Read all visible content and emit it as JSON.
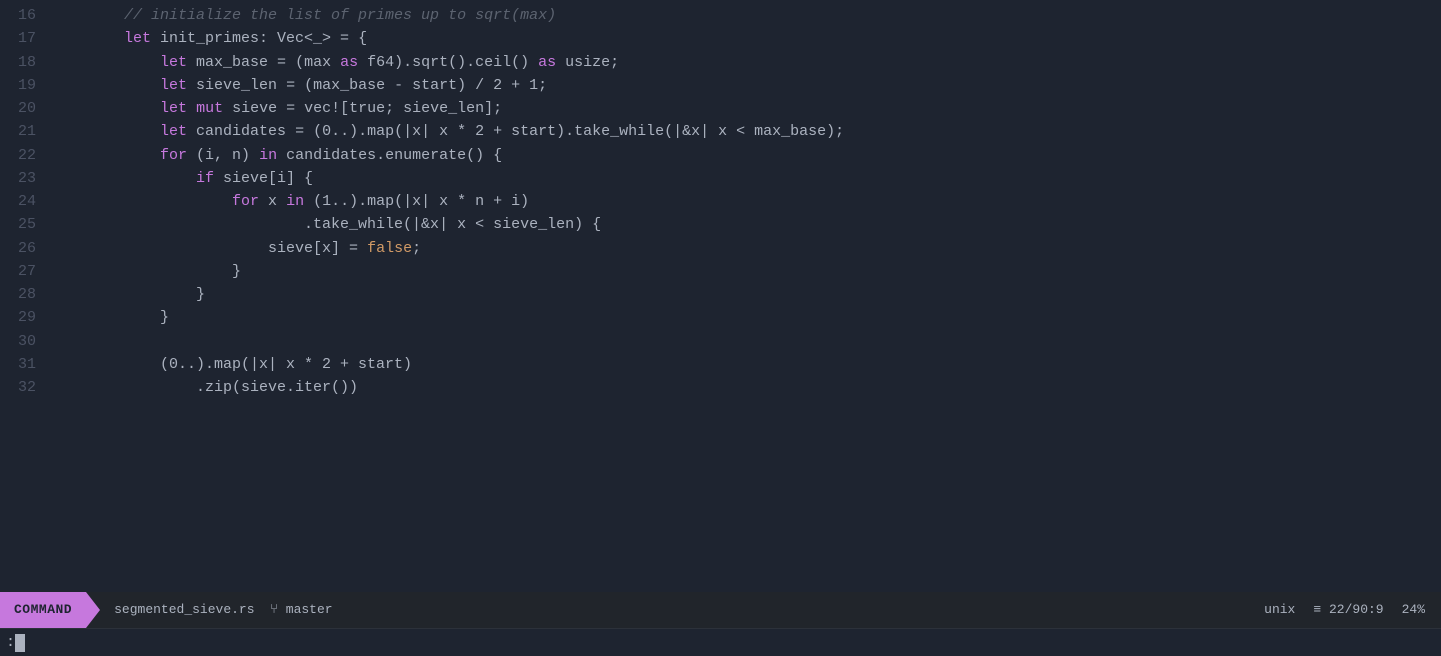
{
  "editor": {
    "lines": [
      {
        "num": "16",
        "tokens": [
          {
            "type": "comment",
            "text": "        // initialize the list of primes up to sqrt(max)"
          }
        ]
      },
      {
        "num": "17",
        "tokens": [
          {
            "type": "plain",
            "text": "        "
          },
          {
            "type": "kw",
            "text": "let"
          },
          {
            "type": "plain",
            "text": " init_primes: Vec<_> = {"
          }
        ]
      },
      {
        "num": "18",
        "tokens": [
          {
            "type": "plain",
            "text": "            "
          },
          {
            "type": "kw",
            "text": "let"
          },
          {
            "type": "plain",
            "text": " max_base = (max "
          },
          {
            "type": "kw",
            "text": "as"
          },
          {
            "type": "plain",
            "text": " f64).sqrt().ceil() "
          },
          {
            "type": "kw",
            "text": "as"
          },
          {
            "type": "plain",
            "text": " usize;"
          }
        ]
      },
      {
        "num": "19",
        "tokens": [
          {
            "type": "plain",
            "text": "            "
          },
          {
            "type": "kw",
            "text": "let"
          },
          {
            "type": "plain",
            "text": " sieve_len = (max_base - start) / 2 + 1;"
          }
        ]
      },
      {
        "num": "20",
        "tokens": [
          {
            "type": "plain",
            "text": "            "
          },
          {
            "type": "kw",
            "text": "let"
          },
          {
            "type": "plain",
            "text": " "
          },
          {
            "type": "kw",
            "text": "mut"
          },
          {
            "type": "plain",
            "text": " sieve = vec![true; sieve_len];"
          }
        ]
      },
      {
        "num": "21",
        "tokens": [
          {
            "type": "plain",
            "text": "            "
          },
          {
            "type": "kw",
            "text": "let"
          },
          {
            "type": "plain",
            "text": " candidates = (0..).map(|x| x * 2 + start).take_while(|&x| x < max_base);"
          }
        ]
      },
      {
        "num": "22",
        "tokens": [
          {
            "type": "plain",
            "text": "            "
          },
          {
            "type": "kw",
            "text": "for"
          },
          {
            "type": "plain",
            "text": " (i, n) "
          },
          {
            "type": "kw",
            "text": "in"
          },
          {
            "type": "plain",
            "text": " candidates.enumerate() {"
          }
        ]
      },
      {
        "num": "23",
        "tokens": [
          {
            "type": "plain",
            "text": "                "
          },
          {
            "type": "kw",
            "text": "if"
          },
          {
            "type": "plain",
            "text": " sieve[i] {"
          }
        ]
      },
      {
        "num": "24",
        "tokens": [
          {
            "type": "plain",
            "text": "                    "
          },
          {
            "type": "kw",
            "text": "for"
          },
          {
            "type": "plain",
            "text": " x "
          },
          {
            "type": "kw",
            "text": "in"
          },
          {
            "type": "plain",
            "text": " (1..).map(|x| x * n + i)"
          }
        ]
      },
      {
        "num": "25",
        "tokens": [
          {
            "type": "plain",
            "text": "                            .take_while(|&x| x < sieve_len) {"
          }
        ]
      },
      {
        "num": "26",
        "tokens": [
          {
            "type": "plain",
            "text": "                        sieve[x] = "
          },
          {
            "type": "bool",
            "text": "false"
          },
          {
            "type": "plain",
            "text": ";"
          }
        ]
      },
      {
        "num": "27",
        "tokens": [
          {
            "type": "plain",
            "text": "                    }"
          }
        ]
      },
      {
        "num": "28",
        "tokens": [
          {
            "type": "plain",
            "text": "                }"
          }
        ]
      },
      {
        "num": "29",
        "tokens": [
          {
            "type": "plain",
            "text": "            }"
          }
        ]
      },
      {
        "num": "30",
        "tokens": []
      },
      {
        "num": "31",
        "tokens": [
          {
            "type": "plain",
            "text": "            (0..).map(|x| x * 2 + start)"
          }
        ]
      },
      {
        "num": "32",
        "tokens": [
          {
            "type": "plain",
            "text": "                .zip(sieve.iter())"
          }
        ]
      }
    ]
  },
  "status_bar": {
    "mode": "COMMAND",
    "filename": "segmented_sieve.rs",
    "branch_icon": "⑂",
    "branch": "master",
    "encoding": "unix",
    "lines_icon": "≡",
    "position": "22/90:9",
    "percent": "24%"
  },
  "cmd_line": {
    "prefix": ":"
  }
}
